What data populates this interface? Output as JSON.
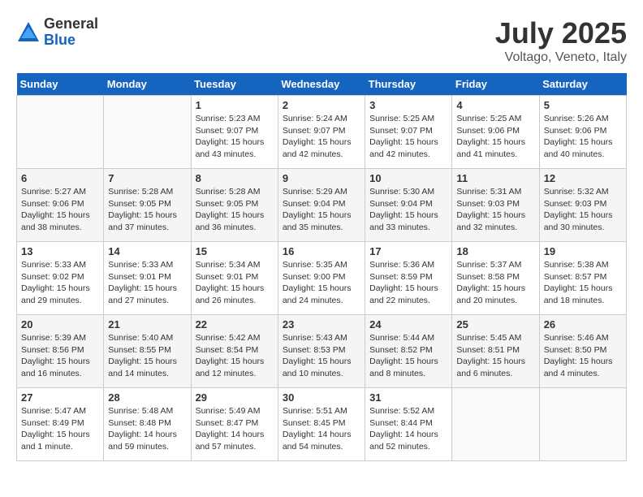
{
  "header": {
    "logo_general": "General",
    "logo_blue": "Blue",
    "title": "July 2025",
    "location": "Voltago, Veneto, Italy"
  },
  "days_of_week": [
    "Sunday",
    "Monday",
    "Tuesday",
    "Wednesday",
    "Thursday",
    "Friday",
    "Saturday"
  ],
  "weeks": [
    [
      {
        "day": "",
        "info": ""
      },
      {
        "day": "",
        "info": ""
      },
      {
        "day": "1",
        "info": "Sunrise: 5:23 AM\nSunset: 9:07 PM\nDaylight: 15 hours\nand 43 minutes."
      },
      {
        "day": "2",
        "info": "Sunrise: 5:24 AM\nSunset: 9:07 PM\nDaylight: 15 hours\nand 42 minutes."
      },
      {
        "day": "3",
        "info": "Sunrise: 5:25 AM\nSunset: 9:07 PM\nDaylight: 15 hours\nand 42 minutes."
      },
      {
        "day": "4",
        "info": "Sunrise: 5:25 AM\nSunset: 9:06 PM\nDaylight: 15 hours\nand 41 minutes."
      },
      {
        "day": "5",
        "info": "Sunrise: 5:26 AM\nSunset: 9:06 PM\nDaylight: 15 hours\nand 40 minutes."
      }
    ],
    [
      {
        "day": "6",
        "info": "Sunrise: 5:27 AM\nSunset: 9:06 PM\nDaylight: 15 hours\nand 38 minutes."
      },
      {
        "day": "7",
        "info": "Sunrise: 5:28 AM\nSunset: 9:05 PM\nDaylight: 15 hours\nand 37 minutes."
      },
      {
        "day": "8",
        "info": "Sunrise: 5:28 AM\nSunset: 9:05 PM\nDaylight: 15 hours\nand 36 minutes."
      },
      {
        "day": "9",
        "info": "Sunrise: 5:29 AM\nSunset: 9:04 PM\nDaylight: 15 hours\nand 35 minutes."
      },
      {
        "day": "10",
        "info": "Sunrise: 5:30 AM\nSunset: 9:04 PM\nDaylight: 15 hours\nand 33 minutes."
      },
      {
        "day": "11",
        "info": "Sunrise: 5:31 AM\nSunset: 9:03 PM\nDaylight: 15 hours\nand 32 minutes."
      },
      {
        "day": "12",
        "info": "Sunrise: 5:32 AM\nSunset: 9:03 PM\nDaylight: 15 hours\nand 30 minutes."
      }
    ],
    [
      {
        "day": "13",
        "info": "Sunrise: 5:33 AM\nSunset: 9:02 PM\nDaylight: 15 hours\nand 29 minutes."
      },
      {
        "day": "14",
        "info": "Sunrise: 5:33 AM\nSunset: 9:01 PM\nDaylight: 15 hours\nand 27 minutes."
      },
      {
        "day": "15",
        "info": "Sunrise: 5:34 AM\nSunset: 9:01 PM\nDaylight: 15 hours\nand 26 minutes."
      },
      {
        "day": "16",
        "info": "Sunrise: 5:35 AM\nSunset: 9:00 PM\nDaylight: 15 hours\nand 24 minutes."
      },
      {
        "day": "17",
        "info": "Sunrise: 5:36 AM\nSunset: 8:59 PM\nDaylight: 15 hours\nand 22 minutes."
      },
      {
        "day": "18",
        "info": "Sunrise: 5:37 AM\nSunset: 8:58 PM\nDaylight: 15 hours\nand 20 minutes."
      },
      {
        "day": "19",
        "info": "Sunrise: 5:38 AM\nSunset: 8:57 PM\nDaylight: 15 hours\nand 18 minutes."
      }
    ],
    [
      {
        "day": "20",
        "info": "Sunrise: 5:39 AM\nSunset: 8:56 PM\nDaylight: 15 hours\nand 16 minutes."
      },
      {
        "day": "21",
        "info": "Sunrise: 5:40 AM\nSunset: 8:55 PM\nDaylight: 15 hours\nand 14 minutes."
      },
      {
        "day": "22",
        "info": "Sunrise: 5:42 AM\nSunset: 8:54 PM\nDaylight: 15 hours\nand 12 minutes."
      },
      {
        "day": "23",
        "info": "Sunrise: 5:43 AM\nSunset: 8:53 PM\nDaylight: 15 hours\nand 10 minutes."
      },
      {
        "day": "24",
        "info": "Sunrise: 5:44 AM\nSunset: 8:52 PM\nDaylight: 15 hours\nand 8 minutes."
      },
      {
        "day": "25",
        "info": "Sunrise: 5:45 AM\nSunset: 8:51 PM\nDaylight: 15 hours\nand 6 minutes."
      },
      {
        "day": "26",
        "info": "Sunrise: 5:46 AM\nSunset: 8:50 PM\nDaylight: 15 hours\nand 4 minutes."
      }
    ],
    [
      {
        "day": "27",
        "info": "Sunrise: 5:47 AM\nSunset: 8:49 PM\nDaylight: 15 hours\nand 1 minute."
      },
      {
        "day": "28",
        "info": "Sunrise: 5:48 AM\nSunset: 8:48 PM\nDaylight: 14 hours\nand 59 minutes."
      },
      {
        "day": "29",
        "info": "Sunrise: 5:49 AM\nSunset: 8:47 PM\nDaylight: 14 hours\nand 57 minutes."
      },
      {
        "day": "30",
        "info": "Sunrise: 5:51 AM\nSunset: 8:45 PM\nDaylight: 14 hours\nand 54 minutes."
      },
      {
        "day": "31",
        "info": "Sunrise: 5:52 AM\nSunset: 8:44 PM\nDaylight: 14 hours\nand 52 minutes."
      },
      {
        "day": "",
        "info": ""
      },
      {
        "day": "",
        "info": ""
      }
    ]
  ]
}
